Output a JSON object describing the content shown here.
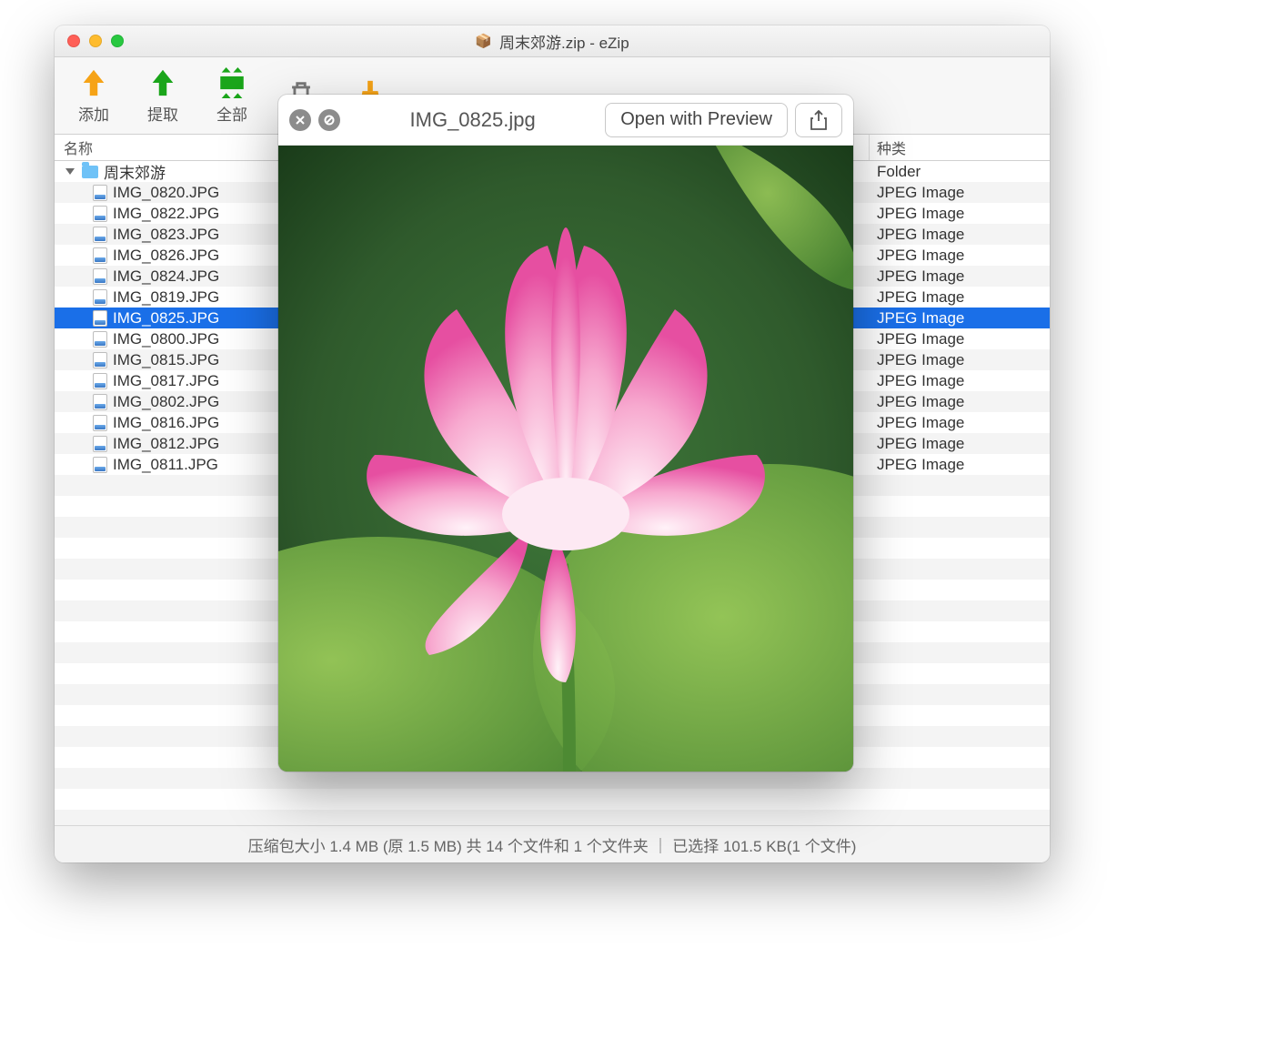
{
  "window": {
    "title_prefix_icon": "📦",
    "title": "周末郊游.zip - eZip"
  },
  "toolbar": {
    "add": "添加",
    "extract": "提取",
    "extract_all_prefix": "全部",
    "delete": "",
    "clean": ""
  },
  "columns": {
    "name": "名称",
    "kind": "种类"
  },
  "tree": {
    "folder_name": "周末郊游",
    "folder_kind": "Folder",
    "files": [
      {
        "name": "IMG_0820.JPG",
        "kind": "JPEG Image",
        "selected": false
      },
      {
        "name": "IMG_0822.JPG",
        "kind": "JPEG Image",
        "selected": false
      },
      {
        "name": "IMG_0823.JPG",
        "kind": "JPEG Image",
        "selected": false
      },
      {
        "name": "IMG_0826.JPG",
        "kind": "JPEG Image",
        "selected": false
      },
      {
        "name": "IMG_0824.JPG",
        "kind": "JPEG Image",
        "selected": false
      },
      {
        "name": "IMG_0819.JPG",
        "kind": "JPEG Image",
        "selected": false
      },
      {
        "name": "IMG_0825.JPG",
        "kind": "JPEG Image",
        "selected": true
      },
      {
        "name": "IMG_0800.JPG",
        "kind": "JPEG Image",
        "selected": false
      },
      {
        "name": "IMG_0815.JPG",
        "kind": "JPEG Image",
        "selected": false
      },
      {
        "name": "IMG_0817.JPG",
        "kind": "JPEG Image",
        "selected": false
      },
      {
        "name": "IMG_0802.JPG",
        "kind": "JPEG Image",
        "selected": false
      },
      {
        "name": "IMG_0816.JPG",
        "kind": "JPEG Image",
        "selected": false
      },
      {
        "name": "IMG_0812.JPG",
        "kind": "JPEG Image",
        "selected": false
      },
      {
        "name": "IMG_0811.JPG",
        "kind": "JPEG Image",
        "selected": false
      }
    ]
  },
  "statusbar": {
    "text": "压缩包大小 1.4 MB (原 1.5 MB) 共 14 个文件和 1 个文件夹  ｜  已选择 101.5 KB(1 个文件)"
  },
  "quicklook": {
    "filename": "IMG_0825.jpg",
    "open_button": "Open with Preview"
  }
}
